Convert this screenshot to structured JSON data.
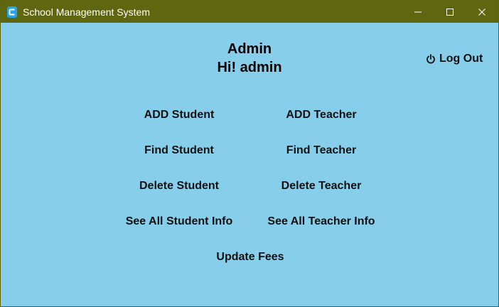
{
  "window": {
    "title": "School Management System",
    "titlebar_color": "#5f6610",
    "background_color": "#87ceeb"
  },
  "header": {
    "role": "Admin",
    "greeting": "Hi! admin"
  },
  "logout": {
    "label": "Log Out",
    "icon": "power-icon"
  },
  "actions": {
    "add_student": "ADD Student",
    "add_teacher": "ADD Teacher",
    "find_student": "Find Student",
    "find_teacher": "Find Teacher",
    "delete_student": "Delete Student",
    "delete_teacher": "Delete Teacher",
    "see_all_student": "See All Student Info",
    "see_all_teacher": "See All Teacher Info",
    "update_fees": "Update Fees"
  }
}
